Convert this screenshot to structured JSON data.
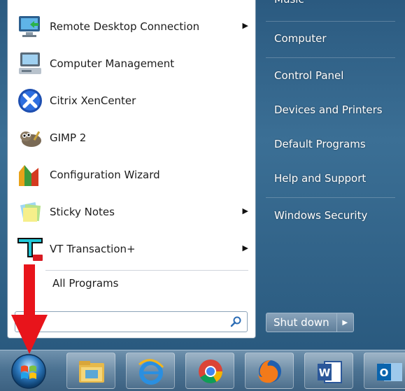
{
  "start_menu": {
    "programs": [
      {
        "label": "Remote Desktop Connection",
        "icon": "remote-desktop-icon",
        "has_submenu": true
      },
      {
        "label": "Computer Management",
        "icon": "computer-management-icon",
        "has_submenu": false
      },
      {
        "label": "Citrix XenCenter",
        "icon": "citrix-xencenter-icon",
        "has_submenu": false
      },
      {
        "label": "GIMP 2",
        "icon": "gimp-icon",
        "has_submenu": false
      },
      {
        "label": "Configuration Wizard",
        "icon": "configuration-wizard-icon",
        "has_submenu": false
      },
      {
        "label": "Sticky Notes",
        "icon": "sticky-notes-icon",
        "has_submenu": true
      },
      {
        "label": "VT Transaction+",
        "icon": "vt-transaction-icon",
        "has_submenu": true
      }
    ],
    "all_programs": "All Programs",
    "search": {
      "value": "",
      "placeholder": ""
    },
    "right_items": {
      "music": "Music",
      "computer": "Computer",
      "control_panel": "Control Panel",
      "devices_printers": "Devices and Printers",
      "default_programs": "Default Programs",
      "help_support": "Help and Support",
      "windows_security": "Windows Security"
    },
    "shutdown_label": "Shut down"
  },
  "taskbar": {
    "pinned": [
      "windows-explorer-icon",
      "internet-explorer-icon",
      "chrome-icon",
      "firefox-icon",
      "word-icon",
      "outlook-icon"
    ]
  },
  "colors": {
    "annotation_arrow": "#e8141b"
  }
}
